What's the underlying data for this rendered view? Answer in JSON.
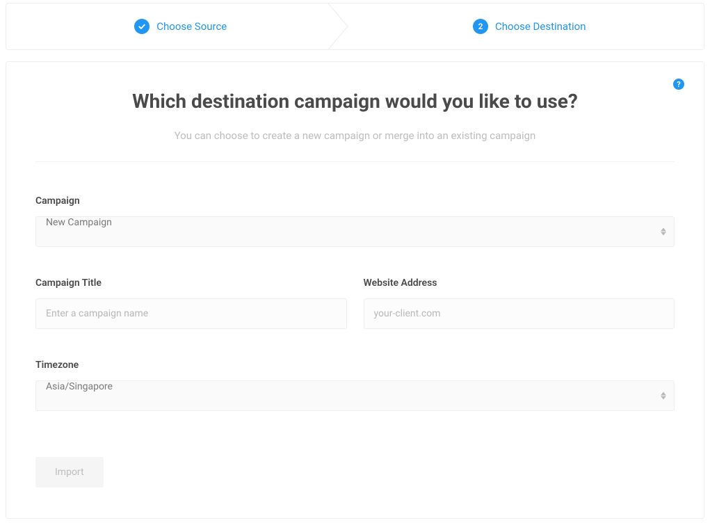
{
  "stepper": {
    "steps": [
      {
        "label": "Choose Source",
        "state": "complete"
      },
      {
        "label": "Choose Destination",
        "state": "active",
        "number": "2"
      }
    ]
  },
  "header": {
    "title": "Which destination campaign would you like to use?",
    "subtitle": "You can choose to create a new campaign or merge into an existing campaign",
    "help_symbol": "?"
  },
  "form": {
    "campaign": {
      "label": "Campaign",
      "value": "New Campaign"
    },
    "campaign_title": {
      "label": "Campaign Title",
      "placeholder": "Enter a campaign name",
      "value": ""
    },
    "website_address": {
      "label": "Website Address",
      "placeholder": "your-client.com",
      "value": ""
    },
    "timezone": {
      "label": "Timezone",
      "value": "Asia/Singapore"
    }
  },
  "actions": {
    "import_label": "Import"
  }
}
